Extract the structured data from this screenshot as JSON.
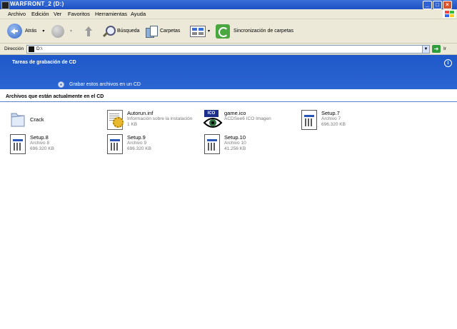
{
  "window": {
    "title": "WARFRONT_2 (D:)"
  },
  "menu": [
    "Archivo",
    "Edición",
    "Ver",
    "Favoritos",
    "Herramientas",
    "Ayuda"
  ],
  "toolbar": {
    "back_label": "Atrás",
    "search_label": "Búsqueda",
    "folders_label": "Carpetas",
    "sync_label": "Sincronización de carpetas"
  },
  "address": {
    "label": "Dirección",
    "value": "D:\\",
    "go_label": "Ir"
  },
  "cd_tasks": {
    "title": "Tareas de grabación de CD",
    "action": "Grabar estos archivos en un CD"
  },
  "files_section": {
    "title": "Archivos que están actualmente en el CD"
  },
  "files": [
    {
      "name": "Crack",
      "type": "",
      "size": "",
      "icon": "folder-icon"
    },
    {
      "name": "Autorun.inf",
      "type": "Información sobre la instalación",
      "size": "1 KB",
      "icon": "setup-info-icon"
    },
    {
      "name": "game.ico",
      "type": "ACDSee6 ICO Imagen",
      "size": "",
      "icon": "ico-image-icon"
    },
    {
      "name": "Setup.7",
      "type": "Archivo 7",
      "size": "696.320 KB",
      "icon": "document-icon"
    },
    {
      "name": "Setup.8",
      "type": "Archivo 8",
      "size": "696.320 KB",
      "icon": "document-icon"
    },
    {
      "name": "Setup.9",
      "type": "Archivo 9",
      "size": "696.320 KB",
      "icon": "document-icon"
    },
    {
      "name": "Setup.10",
      "type": "Archivo 10",
      "size": "41.256 KB",
      "icon": "document-icon"
    }
  ],
  "colors": {
    "titlebar": "#1c4fc4",
    "cd_panel": "#2561cf",
    "chrome": "#ece9d8"
  }
}
